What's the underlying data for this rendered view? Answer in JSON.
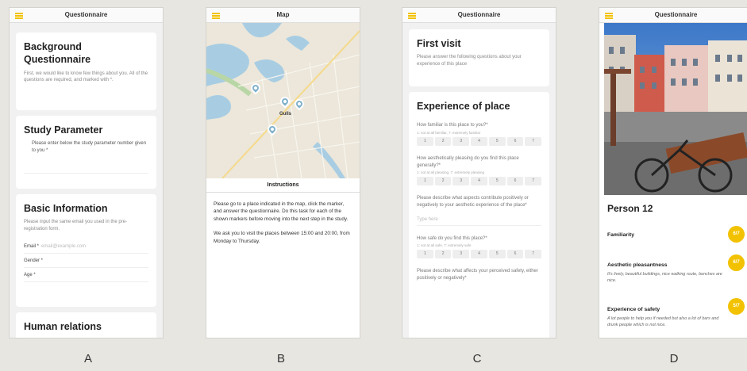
{
  "screens": {
    "a": {
      "caption": "A",
      "title": "Questionnaire",
      "background": {
        "heading": "Background Questionnaire",
        "text": "First, we would like to know few things about you. All of the questions are required, and marked with *."
      },
      "study": {
        "heading": "Study Parameter",
        "text": "Please enter below the study parameter number given to you *"
      },
      "basic": {
        "heading": "Basic Information",
        "text": "Please input the same email you used in the pre-registration form.",
        "email_label": "Email *",
        "email_placeholder": "email@example.com",
        "gender_label": "Gender *",
        "age_label": "Age *"
      },
      "human": {
        "heading": "Human relations"
      }
    },
    "b": {
      "caption": "B",
      "title": "Map",
      "map_label": "Gulls",
      "instructions_title": "Instructions",
      "para1": "Please go to a place indicated in the map, click the marker, and answer the questionnaire. Do this task for each of the shown markers before moving into the next step in the study.",
      "para2": "We ask you to visit the places between 15:00 and 20:00, from Monday to Thursday."
    },
    "c": {
      "caption": "C",
      "title": "Questionnaire",
      "first_visit": {
        "heading": "First visit",
        "text": "Please answer the following questions about your experience of this place"
      },
      "experience": {
        "heading": "Experience of place",
        "q1": "How familiar is this place to you?*",
        "q1_hint": "1: not at all familiar, 7: extremely familiar",
        "q2": "How aesthetically pleasing do you find this place generally?*",
        "q2_hint": "1: not at all pleasing, 7: extremely pleasing",
        "q3": "Please describe what aspects contribute positively or negatively to your aesthetic experience of the place*",
        "type_here": "Type here",
        "q4": "How safe do you find this place?*",
        "q4_hint": "1: not at all safe, 7: extremely safe",
        "q5": "Please describe what affects your perceived safety, either positively or negatively*"
      },
      "scale_values": [
        "1",
        "2",
        "3",
        "4",
        "5",
        "6",
        "7"
      ]
    },
    "d": {
      "caption": "D",
      "title": "Questionnaire",
      "person": "Person 12",
      "items": [
        {
          "label": "Familiarity",
          "score": "6/7",
          "note": ""
        },
        {
          "label": "Aesthetic pleasantness",
          "score": "6/7",
          "note": "It's lively, beautiful buildings, nice walking route, benches are nice."
        },
        {
          "label": "Experience of safety",
          "score": "5/7",
          "note": "A lot people to help you if needed but also a lot of bars and drunk people which is not nice."
        }
      ]
    }
  },
  "colors": {
    "accent": "#f2c200",
    "pin": "#7fb0cc",
    "water": "#a8cde3"
  }
}
